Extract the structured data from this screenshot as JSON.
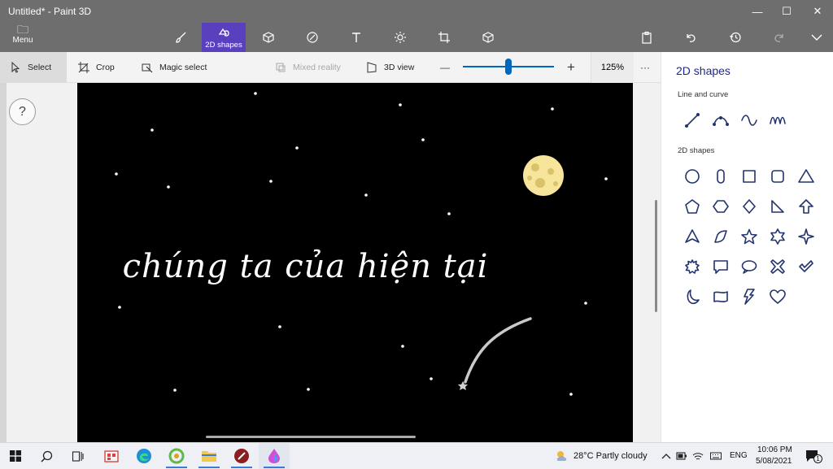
{
  "window": {
    "title": "Untitled* - Paint 3D",
    "minimize": "—",
    "maximize": "☐",
    "close": "✕"
  },
  "toolbar": {
    "menu_label": "Menu",
    "active_tool_label": "2D shapes"
  },
  "subbar": {
    "select": "Select",
    "crop": "Crop",
    "magic_select": "Magic select",
    "mixed_reality": "Mixed reality",
    "view_3d": "3D view",
    "zoom_minus": "—",
    "zoom_plus": "+",
    "zoom_value": "125%",
    "more": "···",
    "zoom_level_percent": 50
  },
  "help": {
    "label": "?"
  },
  "canvas": {
    "text": "chúng ta của hiện tại",
    "background": "#000000",
    "moon_color": "#f6e59a"
  },
  "panel": {
    "title": "2D shapes",
    "line_section": "Line and curve",
    "shape_section": "2D shapes",
    "line_tools": [
      "line-icon",
      "curve-icon",
      "s-curve-icon",
      "wave-curve-icon"
    ],
    "shapes": [
      "circle-icon",
      "rounded-oval-icon",
      "square-icon",
      "rounded-square-icon",
      "triangle-icon",
      "pentagon-icon",
      "hexagon-icon",
      "diamond-icon",
      "right-triangle-icon",
      "arrow-up-icon",
      "tent-icon",
      "leaf-icon",
      "star-icon",
      "six-point-star-icon",
      "four-point-star-icon",
      "burst-icon",
      "speech-bubble-icon",
      "thought-bubble-icon",
      "x-mark-icon",
      "check-mark-icon",
      "crescent-moon-icon",
      "ribbon-icon",
      "lightning-icon",
      "heart-icon"
    ]
  },
  "taskbar": {
    "weather": "28°C  Partly cloudy",
    "language": "ENG",
    "time": "10:06 PM",
    "date": "5/08/2021",
    "notifications": "1"
  },
  "colors": {
    "accent": "#5a3fbf",
    "toolbar": "#6e6e6e",
    "shape_stroke": "#23336e",
    "zoom": "#0067c0"
  }
}
